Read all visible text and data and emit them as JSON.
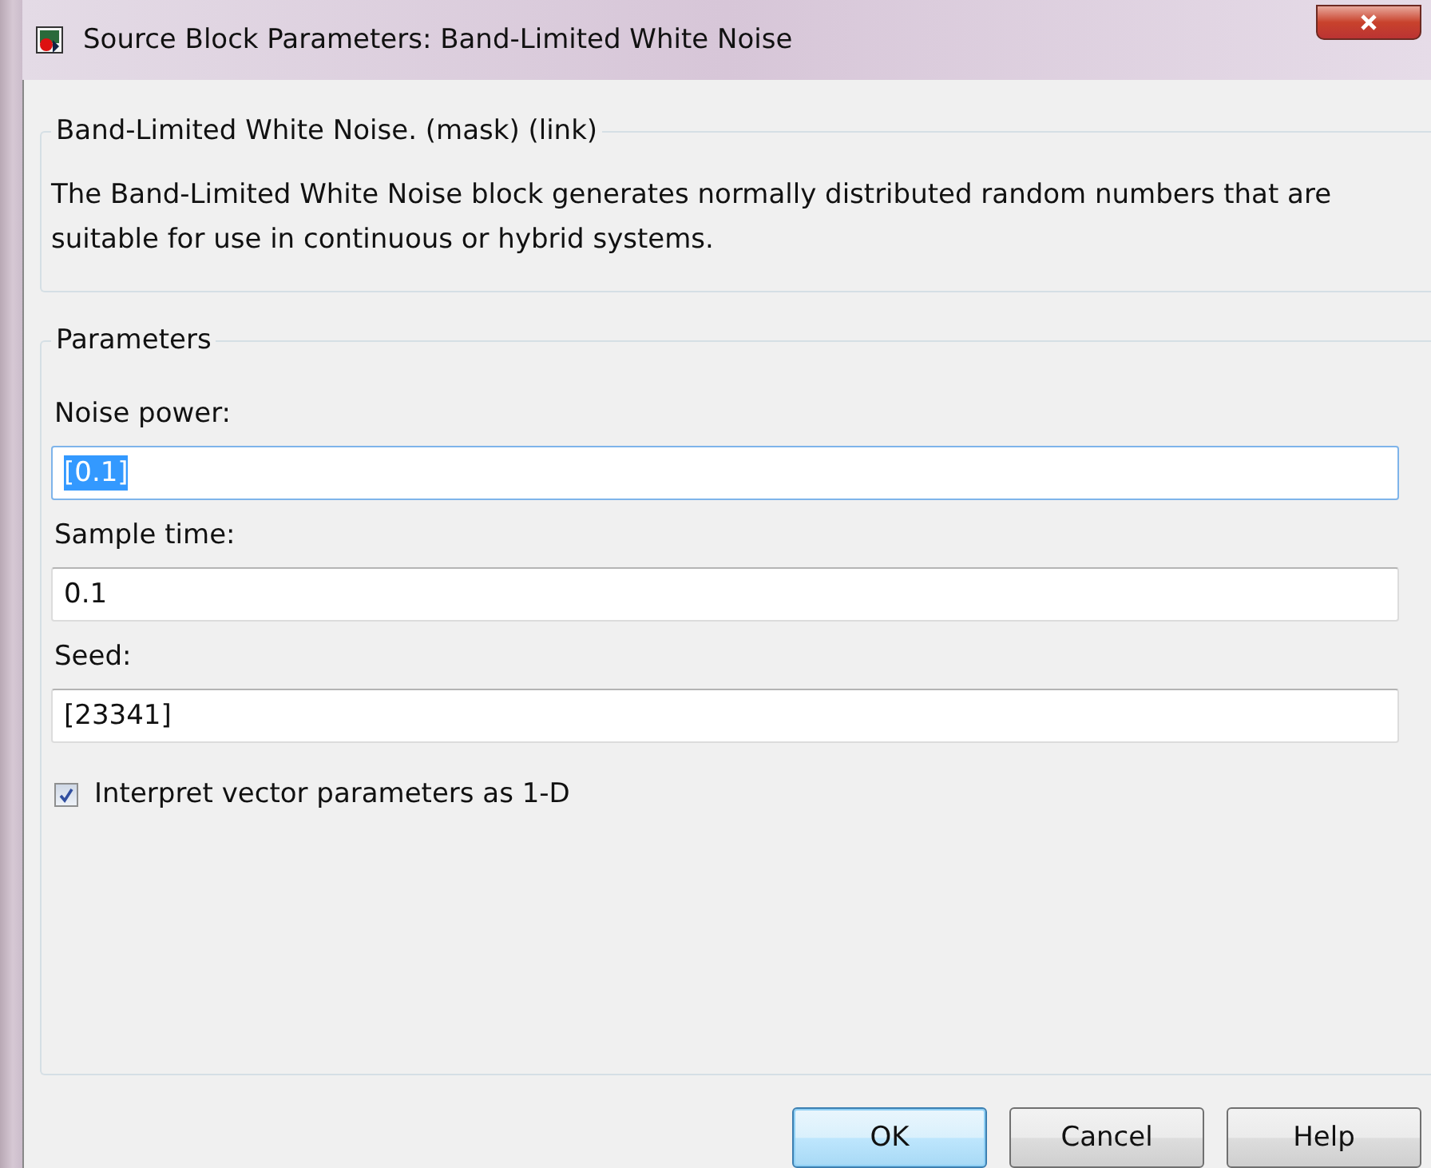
{
  "window": {
    "title": "Source Block Parameters: Band-Limited White Noise"
  },
  "description": {
    "title": "Band-Limited White Noise. (mask) (link)",
    "text": "The Band-Limited White Noise block generates normally distributed random numbers that are suitable for use in continuous or hybrid systems."
  },
  "parameters": {
    "title": "Parameters",
    "fields": [
      {
        "label": "Noise power:",
        "value": "[0.1]",
        "focused": true
      },
      {
        "label": "Sample time:",
        "value": "0.1",
        "focused": false
      },
      {
        "label": "Seed:",
        "value": "[23341]",
        "focused": false
      }
    ],
    "checkbox": {
      "label": "Interpret vector parameters as 1-D",
      "checked": true
    }
  },
  "buttons": [
    {
      "label": "OK",
      "default": true
    },
    {
      "label": "Cancel",
      "default": false
    },
    {
      "label": "Help",
      "default": false
    }
  ]
}
